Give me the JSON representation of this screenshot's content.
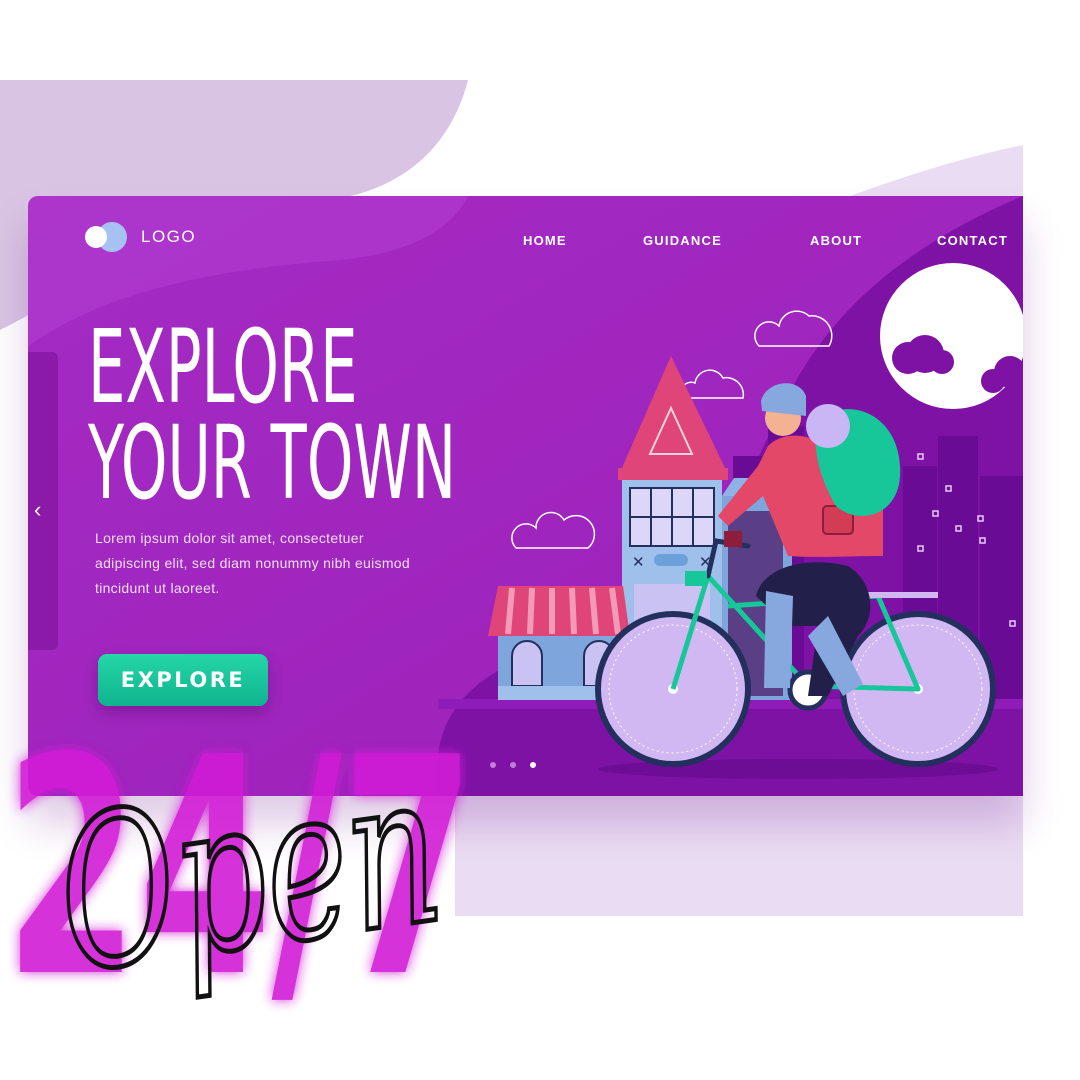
{
  "logo": {
    "text": "LOGO"
  },
  "nav": {
    "items": [
      "HOME",
      "GUIDANCE",
      "ABOUT",
      "CONTACT"
    ]
  },
  "hero": {
    "title_line1": "EXPLORE",
    "title_line2": "YOUR TOWN",
    "description": "Lorem ipsum dolor sit amet, consectetuer adipiscing elit, sed diam nonummy nibh euismod tincidunt ut laoreet.",
    "button_label": "EXPLORE"
  },
  "slider": {
    "total": 3,
    "active_index": 2
  },
  "overlay": {
    "number": "24/7",
    "script_word": "Open"
  },
  "colors": {
    "panel": "#9e24be",
    "accent": "#17c79a",
    "overlay_number": "#d21ad6",
    "decor_lavender": "#d8c4e2"
  },
  "icons": [
    "chevron-left-icon",
    "logo-mark-icon"
  ]
}
